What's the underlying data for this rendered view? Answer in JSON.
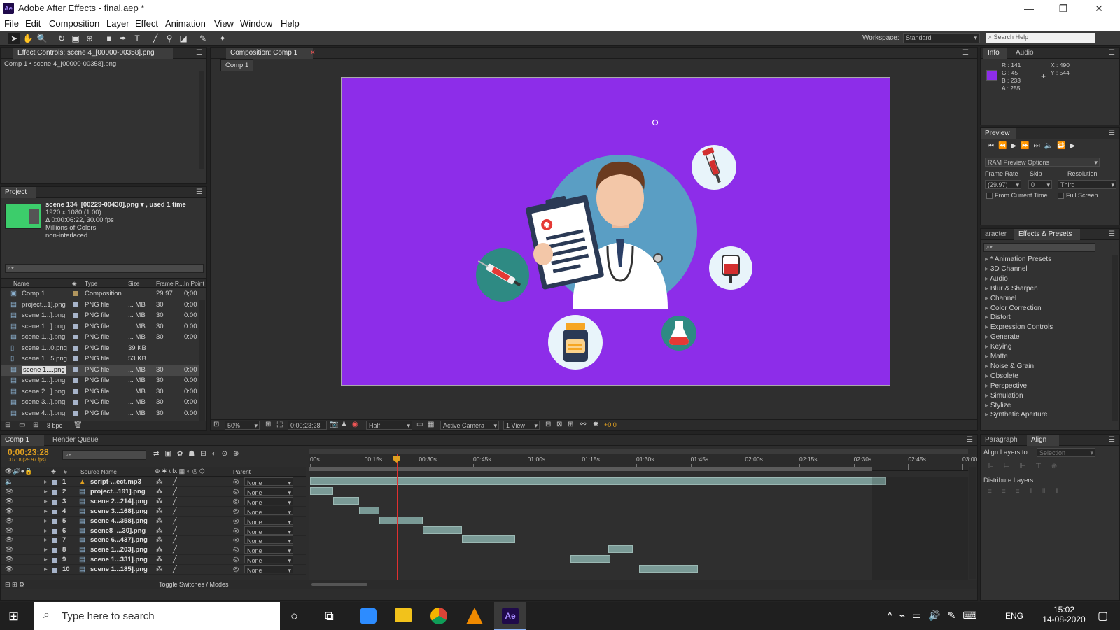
{
  "window": {
    "title": "Adobe After Effects - final.aep *",
    "logo": "Ae",
    "minimize": "—",
    "maximize": "❐",
    "close": "✕"
  },
  "menu": [
    "File",
    "Edit",
    "Composition",
    "Layer",
    "Effect",
    "Animation",
    "View",
    "Window",
    "Help"
  ],
  "toolbar": {
    "tools": [
      "selection-tool",
      "hand-tool",
      "zoom-tool",
      "rotation-tool",
      "camera-tool",
      "pan-behind-tool",
      "rectangle-tool",
      "pen-tool",
      "type-tool",
      "brush-tool",
      "clone-stamp-tool",
      "eraser-tool",
      "roto-brush-tool",
      "puppet-pin-tool"
    ],
    "workspace_label": "Workspace:",
    "workspace_value": "Standard",
    "search_placeholder": "Search Help"
  },
  "effect_controls": {
    "tab": "Effect Controls: scene 4_[00000-00358].png",
    "breadcrumb": "Comp 1 • scene 4_[00000-00358].png"
  },
  "project": {
    "tab": "Project",
    "selected_name": "scene 134_[00229-00430].png ▾ , used 1 time",
    "details": [
      "1920 x 1080 (1.00)",
      "Δ 0:00:06:22, 30.00 fps",
      "Millions of Colors",
      "non-interlaced"
    ],
    "columns": [
      "Name",
      "Type",
      "Size",
      "Frame R...",
      "In Point"
    ],
    "items": [
      {
        "name": "Comp 1",
        "type": "Composition",
        "size": "",
        "fps": "29.97",
        "in": "0;00",
        "color": "#b0955e",
        "icon": "comp"
      },
      {
        "name": "project...1].png",
        "type": "PNG file",
        "size": "... MB",
        "fps": "30",
        "in": "0:00",
        "color": "#a6b3c9",
        "icon": "seq"
      },
      {
        "name": "scene 1...].png",
        "type": "PNG file",
        "size": "... MB",
        "fps": "30",
        "in": "0:00",
        "color": "#a6b3c9",
        "icon": "seq"
      },
      {
        "name": "scene 1...].png",
        "type": "PNG file",
        "size": "... MB",
        "fps": "30",
        "in": "0:00",
        "color": "#a6b3c9",
        "icon": "seq"
      },
      {
        "name": "scene 1...].png",
        "type": "PNG file",
        "size": "... MB",
        "fps": "30",
        "in": "0:00",
        "color": "#a6b3c9",
        "icon": "seq"
      },
      {
        "name": "scene 1...0.png",
        "type": "PNG file",
        "size": "39 KB",
        "fps": "",
        "in": "",
        "color": "#a6b3c9",
        "icon": "file"
      },
      {
        "name": "scene 1...5.png",
        "type": "PNG file",
        "size": "53 KB",
        "fps": "",
        "in": "",
        "color": "#a6b3c9",
        "icon": "file"
      },
      {
        "name": "scene 1....png",
        "type": "PNG file",
        "size": "... MB",
        "fps": "30",
        "in": "0:00",
        "color": "#a6b3c9",
        "icon": "seq",
        "selected": true
      },
      {
        "name": "scene 1...].png",
        "type": "PNG file",
        "size": "... MB",
        "fps": "30",
        "in": "0:00",
        "color": "#a6b3c9",
        "icon": "seq"
      },
      {
        "name": "scene 2...].png",
        "type": "PNG file",
        "size": "... MB",
        "fps": "30",
        "in": "0:00",
        "color": "#a6b3c9",
        "icon": "seq"
      },
      {
        "name": "scene 3...].png",
        "type": "PNG file",
        "size": "... MB",
        "fps": "30",
        "in": "0:00",
        "color": "#a6b3c9",
        "icon": "seq"
      },
      {
        "name": "scene 4...].png",
        "type": "PNG file",
        "size": "... MB",
        "fps": "30",
        "in": "0:00",
        "color": "#a6b3c9",
        "icon": "seq"
      }
    ],
    "bpc": "8 bpc"
  },
  "composition": {
    "tab": "Composition: Comp 1",
    "subtab": "Comp 1",
    "background": "#8d2de9",
    "footer": {
      "zoom": "50%",
      "timecode": "0;00;23;28",
      "resolution": "Half",
      "camera": "Active Camera",
      "view": "1 View",
      "exposure": "+0.0"
    }
  },
  "info": {
    "tabs": [
      "Info",
      "Audio"
    ],
    "r": "R : 141",
    "g": "G : 45",
    "b": "B : 233",
    "a": "A : 255",
    "x": "X : 490",
    "y": "Y : 544",
    "color": "#8d2de9"
  },
  "preview": {
    "tab": "Preview",
    "ram_options": "RAM Preview Options",
    "frame_rate_label": "Frame Rate",
    "skip_label": "Skip",
    "resolution_label": "Resolution",
    "frame_rate": "(29.97)",
    "skip": "0",
    "resolution": "Third",
    "from_current": "From Current Time",
    "full_screen": "Full Screen"
  },
  "effects": {
    "tabs": [
      "aracter",
      "Effects & Presets"
    ],
    "items": [
      "* Animation Presets",
      "3D Channel",
      "Audio",
      "Blur & Sharpen",
      "Channel",
      "Color Correction",
      "Distort",
      "Expression Controls",
      "Generate",
      "Keying",
      "Matte",
      "Noise & Grain",
      "Obsolete",
      "Perspective",
      "Simulation",
      "Stylize",
      "Synthetic Aperture"
    ]
  },
  "align": {
    "tabs": [
      "Paragraph",
      "Align"
    ],
    "align_layers_label": "Align Layers to:",
    "align_target": "Selection",
    "distribute_label": "Distribute Layers:"
  },
  "timeline": {
    "tabs": [
      "Comp 1",
      "Render Queue"
    ],
    "timecode": "0;00;23;28",
    "timecode_sub": "00718 (29.97 fps)",
    "source_header": "Source Name",
    "parent_header": "Parent",
    "ruler": [
      "00s",
      "00:15s",
      "00:30s",
      "00:45s",
      "01:00s",
      "01:15s",
      "01:30s",
      "01:45s",
      "02:00s",
      "02:15s",
      "02:30s",
      "02:45s",
      "03:00"
    ],
    "ruler_end_seconds": 180,
    "playhead_seconds": 23.9,
    "work_area_end_seconds": 155,
    "layers": [
      {
        "num": "1",
        "name": "script-...ect.mp3",
        "parent": "None",
        "audio": true,
        "start": 0,
        "end": 159
      },
      {
        "num": "2",
        "name": "project...191].png",
        "parent": "None",
        "start": 0,
        "end": 6.4
      },
      {
        "num": "3",
        "name": "scene 2...214].png",
        "parent": "None",
        "start": 6.4,
        "end": 13.5
      },
      {
        "num": "4",
        "name": "scene 3...168].png",
        "parent": "None",
        "start": 13.5,
        "end": 19.1
      },
      {
        "num": "5",
        "name": "scene 4...358].png",
        "parent": "None",
        "start": 19.1,
        "end": 31.0
      },
      {
        "num": "6",
        "name": "scene8_...30].png",
        "parent": "None",
        "start": 31.0,
        "end": 42.0
      },
      {
        "num": "7",
        "name": "scene 6...437].png",
        "parent": "None",
        "start": 42.0,
        "end": 56.6
      },
      {
        "num": "8",
        "name": "scene 1...203].png",
        "parent": "None",
        "start": 82.3,
        "end": 89.0
      },
      {
        "num": "9",
        "name": "scene 1...331].png",
        "parent": "None",
        "start": 71.9,
        "end": 82.8
      },
      {
        "num": "10",
        "name": "scene 1...185].png",
        "parent": "None",
        "start": 90.8,
        "end": 106.9
      }
    ],
    "toggle_label": "Toggle Switches / Modes"
  },
  "taskbar": {
    "search_placeholder": "Type here to search",
    "apps": [
      "cortana-icon",
      "task-view-icon",
      "zoom-app-icon",
      "file-explorer-icon",
      "chrome-icon",
      "vlc-icon",
      "after-effects-icon"
    ],
    "ae_label": "Ae",
    "lang": "ENG",
    "time": "15:02",
    "date": "14-08-2020"
  }
}
